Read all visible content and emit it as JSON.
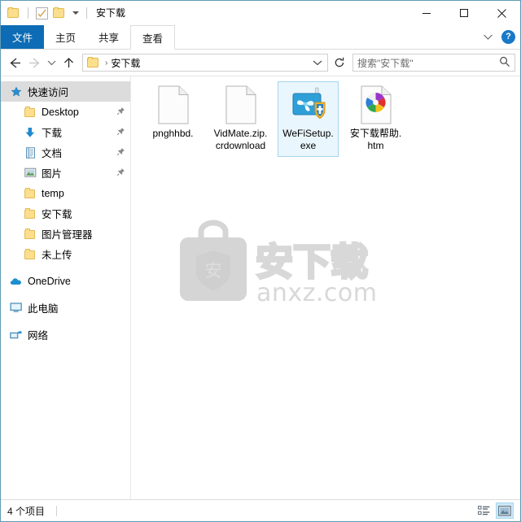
{
  "window": {
    "title": "安下载",
    "quick_access_toolbar": [
      {
        "name": "explorer-icon",
        "label": "资源管理器"
      },
      {
        "name": "properties-icon",
        "label": "属性"
      },
      {
        "name": "new-folder-icon",
        "label": "新建文件夹"
      },
      {
        "name": "customize-caret",
        "label": "自定义快速访问工具栏"
      }
    ],
    "controls": {
      "minimize": "最小化",
      "maximize": "最大化",
      "close": "关闭"
    }
  },
  "ribbon": {
    "tabs": [
      {
        "label": "文件",
        "state": "file"
      },
      {
        "label": "主页",
        "state": "normal"
      },
      {
        "label": "共享",
        "state": "normal"
      },
      {
        "label": "查看",
        "state": "active"
      }
    ],
    "collapse_label": "",
    "help_label": "?"
  },
  "address": {
    "back_label": "后退",
    "forward_label": "前进",
    "history_label": "最近浏览的位置",
    "up_label": "上移到",
    "breadcrumb": "安下载",
    "breadcrumb_separator": "›",
    "refresh_label": "刷新",
    "dropdown_label": ""
  },
  "search": {
    "placeholder": "搜索\"安下载\"",
    "icon": "search-icon"
  },
  "sidebar": {
    "items": [
      {
        "label": "快速访问",
        "icon": "star-icon",
        "depth": 0,
        "selected": true,
        "pinned": false
      },
      {
        "label": "Desktop",
        "icon": "folder-icon",
        "depth": 1,
        "selected": false,
        "pinned": true
      },
      {
        "label": "下载",
        "icon": "download-icon",
        "depth": 1,
        "selected": false,
        "pinned": true
      },
      {
        "label": "文档",
        "icon": "documents-icon",
        "depth": 1,
        "selected": false,
        "pinned": true
      },
      {
        "label": "图片",
        "icon": "pictures-icon",
        "depth": 1,
        "selected": false,
        "pinned": true
      },
      {
        "label": "temp",
        "icon": "folder-icon",
        "depth": 1,
        "selected": false,
        "pinned": false
      },
      {
        "label": "安下载",
        "icon": "folder-icon",
        "depth": 1,
        "selected": false,
        "pinned": false
      },
      {
        "label": "图片管理器",
        "icon": "folder-icon",
        "depth": 1,
        "selected": false,
        "pinned": false
      },
      {
        "label": "未上传",
        "icon": "folder-icon",
        "depth": 1,
        "selected": false,
        "pinned": false
      },
      {
        "label": "OneDrive",
        "icon": "cloud-icon",
        "depth": 0,
        "selected": false,
        "pinned": false
      },
      {
        "label": "此电脑",
        "icon": "computer-icon",
        "depth": 0,
        "selected": false,
        "pinned": false
      },
      {
        "label": "网络",
        "icon": "network-icon",
        "depth": 0,
        "selected": false,
        "pinned": false
      }
    ]
  },
  "files": [
    {
      "name": "pnghhbd.",
      "icon": "blank-file-icon",
      "selected": false
    },
    {
      "name": "VidMate.zip.crdownload",
      "icon": "blank-file-icon",
      "selected": false
    },
    {
      "name": "WeFiSetup.exe",
      "icon": "wefi-app-icon",
      "selected": true
    },
    {
      "name": "安下载帮助.htm",
      "icon": "html-pinwheel-icon",
      "selected": false
    }
  ],
  "watermark": {
    "brand": "安下载",
    "domain": "anxz.com",
    "shield_char": "安"
  },
  "statusbar": {
    "item_count": "4 个项目",
    "views": [
      {
        "name": "details-view-button",
        "label": "详细信息",
        "active": false
      },
      {
        "name": "large-icons-view-button",
        "label": "大图标",
        "active": true
      }
    ]
  },
  "colors": {
    "accent": "#0d6cb5",
    "selection_border": "#a6d5ee",
    "selection_fill": "#eaf6fd",
    "window_border": "#5f9bb5",
    "folder_yellow": "#fdde8e"
  }
}
